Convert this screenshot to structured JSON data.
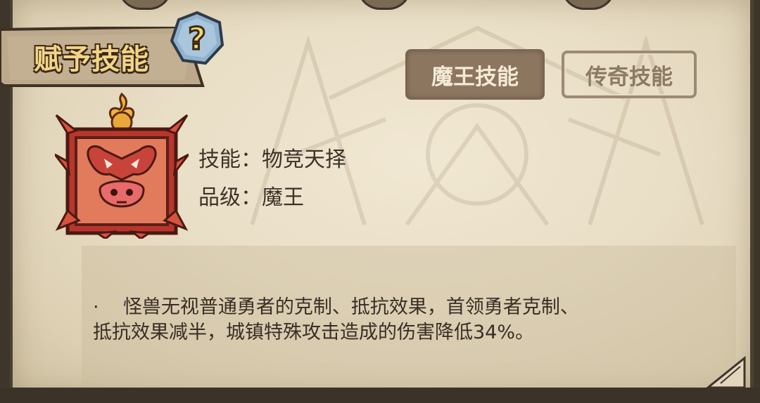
{
  "header": {
    "title": "赋予技能",
    "help_icon": "question-mark-icon"
  },
  "tabs": [
    {
      "label": "魔王技能",
      "active": true
    },
    {
      "label": "传奇技能",
      "active": false
    }
  ],
  "skill": {
    "icon": "demon-ox-skill-icon",
    "name_line": "技能：物竞天择",
    "grade_line": "品级：魔王",
    "description_line1": "·    怪兽无视普通勇者的克制、抵抗效果，首领勇者克制、",
    "description_line2": "抵抗效果减半，城镇特殊攻击造成的伤害降低34%。"
  },
  "colors": {
    "parchment": "#e9dec6",
    "title_gold": "#f2d488",
    "tab_active_bg": "#8c7660",
    "text_dark": "#3d3228",
    "icon_red": "#c8433a"
  }
}
